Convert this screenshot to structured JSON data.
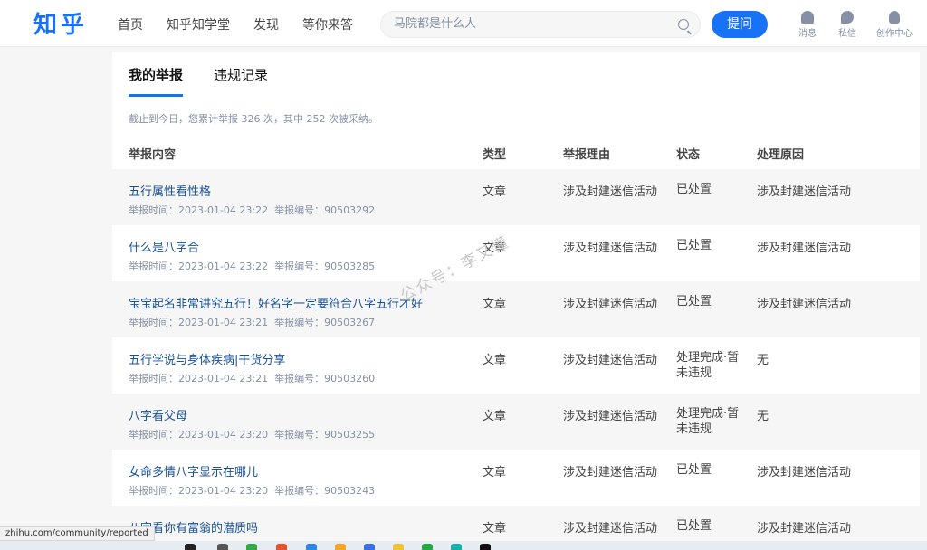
{
  "header": {
    "logo": "知乎",
    "nav": [
      "首页",
      "知乎知学堂",
      "发现",
      "等你来答"
    ],
    "search_placeholder": "马院都是什么人",
    "ask_label": "提问",
    "icons": [
      {
        "name": "bell-icon",
        "label": "消息"
      },
      {
        "name": "chat-icon",
        "label": "私信"
      },
      {
        "name": "user-icon",
        "label": "创作中心"
      }
    ]
  },
  "tabs": [
    "我的举报",
    "违规记录"
  ],
  "summary": "截止到今日，您累计举报 326 次，其中 252 次被采纳。",
  "columns": [
    "举报内容",
    "类型",
    "举报理由",
    "状态",
    "处理原因"
  ],
  "meta_labels": {
    "time": "举报时间：",
    "id": "举报编号："
  },
  "rows": [
    {
      "title": "五行属性看性格",
      "time": "2023-01-04 23:22",
      "id": "90503292",
      "type": "文章",
      "reason": "涉及封建迷信活动",
      "status": "已处置",
      "cause": "涉及封建迷信活动"
    },
    {
      "title": "什么是八字合",
      "time": "2023-01-04 23:22",
      "id": "90503285",
      "type": "文章",
      "reason": "涉及封建迷信活动",
      "status": "已处置",
      "cause": "涉及封建迷信活动"
    },
    {
      "title": "宝宝起名非常讲究五行！好名字一定要符合八字五行才好",
      "time": "2023-01-04 23:21",
      "id": "90503267",
      "type": "文章",
      "reason": "涉及封建迷信活动",
      "status": "已处置",
      "cause": "涉及封建迷信活动"
    },
    {
      "title": "五行学说与身体疾病|干货分享",
      "time": "2023-01-04 23:21",
      "id": "90503260",
      "type": "文章",
      "reason": "涉及封建迷信活动",
      "status": "处理完成·暂未违规",
      "cause": "无"
    },
    {
      "title": "八字看父母",
      "time": "2023-01-04 23:20",
      "id": "90503255",
      "type": "文章",
      "reason": "涉及封建迷信活动",
      "status": "处理完成·暂未违规",
      "cause": "无"
    },
    {
      "title": "女命多情八字显示在哪儿",
      "time": "2023-01-04 23:20",
      "id": "90503243",
      "type": "文章",
      "reason": "涉及封建迷信活动",
      "status": "已处置",
      "cause": "涉及封建迷信活动"
    },
    {
      "title": "八字看你有富翁的潜质吗",
      "time": "",
      "id": "",
      "type": "文章",
      "reason": "涉及封建迷信活动",
      "status": "已处置",
      "cause": "涉及封建迷信活动"
    }
  ],
  "watermark": "公众号：李又懂",
  "statusbar": "zhihu.com/community/reported"
}
